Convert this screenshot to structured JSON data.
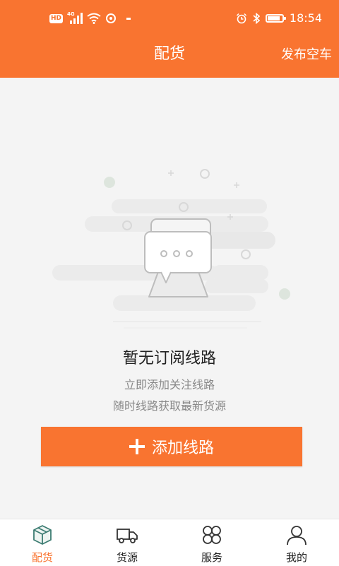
{
  "status_bar": {
    "hd": "HD",
    "network": "4G",
    "time": "18:54",
    "battery_level": 0.85
  },
  "header": {
    "title": "配货",
    "publish_label": "发布空车",
    "bg_color": "#f97430"
  },
  "empty_state": {
    "title": "暂无订阅线路",
    "line1": "立即添加关注线路",
    "line2": "随时线路获取最新货源",
    "illustration_icon": "chat-bubbles-icon"
  },
  "add_button": {
    "label": "添加线路",
    "icon": "plus-icon"
  },
  "nav": {
    "active_color": "#f97430",
    "items": [
      {
        "label": "配货",
        "icon": "package-icon",
        "active": true
      },
      {
        "label": "货源",
        "icon": "truck-icon",
        "active": false
      },
      {
        "label": "服务",
        "icon": "service-grid-icon",
        "active": false
      },
      {
        "label": "我的",
        "icon": "user-icon",
        "active": false
      }
    ]
  }
}
